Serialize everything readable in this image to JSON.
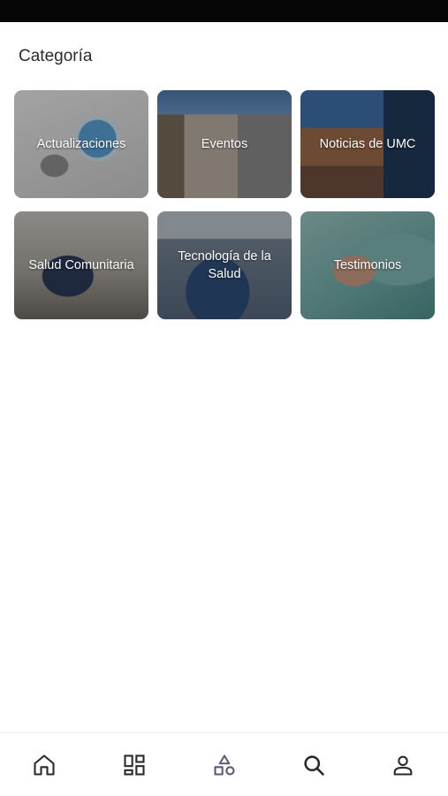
{
  "header": {
    "title": "Categoría"
  },
  "categories": [
    {
      "label": "Actualizaciones"
    },
    {
      "label": "Eventos"
    },
    {
      "label": "Noticias de UMC"
    },
    {
      "label": "Salud Comunitaria"
    },
    {
      "label": "Tecnología de la Salud"
    },
    {
      "label": "Testimonios"
    }
  ],
  "bottom_nav": {
    "items": [
      {
        "icon": "home-icon"
      },
      {
        "icon": "grid-icon"
      },
      {
        "icon": "shapes-icon",
        "active": true
      },
      {
        "icon": "search-icon"
      },
      {
        "icon": "user-icon"
      }
    ]
  },
  "colors": {
    "active_nav": "#5e5a76",
    "nav_icon": "#2a2a2a"
  }
}
